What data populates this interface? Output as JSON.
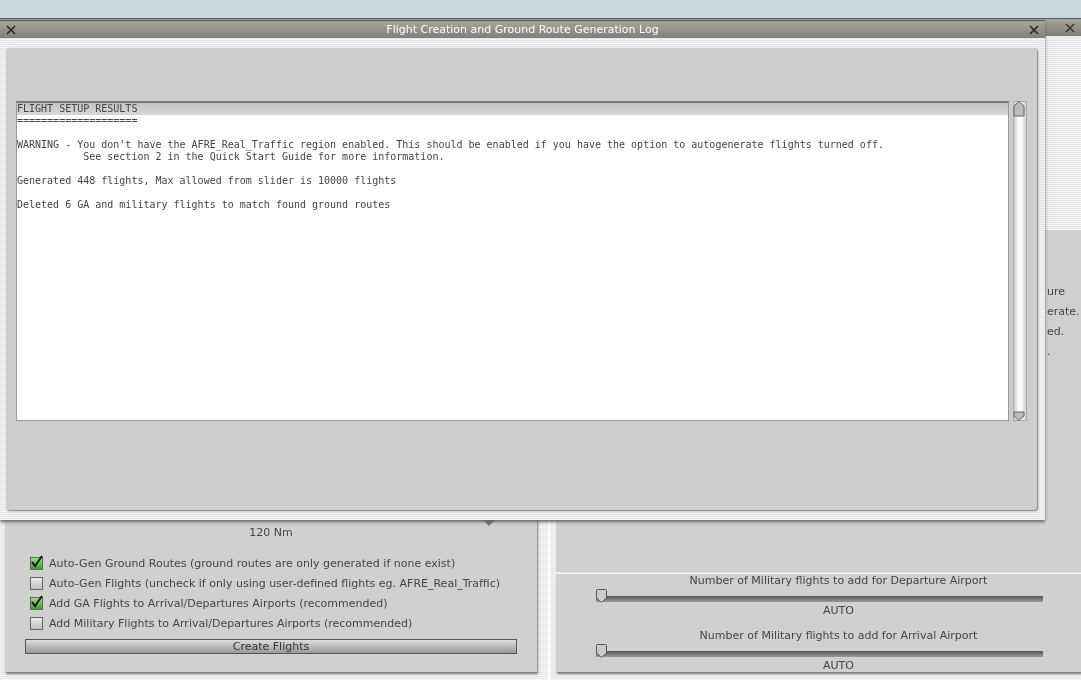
{
  "background_window": {
    "left_panel": {
      "distance": "120 Nm",
      "options": [
        {
          "label": "Auto-Gen Ground Routes (ground routes are only generated if none exist)",
          "checked": true
        },
        {
          "label": "Auto-Gen Flights (uncheck if only using user-defined flights eg. AFRE_Real_Traffic)",
          "checked": false
        },
        {
          "label": "Add GA Flights to Arrival/Departures Airports (recommended)",
          "checked": true
        },
        {
          "label": "Add Military Flights to Arrival/Departures Airports (recommended)",
          "checked": false
        }
      ],
      "button": "Create Flights"
    },
    "right_panel": {
      "text_lines": [
        "ure",
        "erate.",
        "ed.",
        "."
      ],
      "sliders": [
        {
          "label": "Number of Military flights to add for Departure Airport",
          "level": 0,
          "reading": "AUTO"
        },
        {
          "label": "Number of Military flights to add for Arrival Airport",
          "level": 0,
          "reading": "AUTO"
        }
      ]
    }
  },
  "dialog": {
    "title": "Flight Creation and Ground Route Generation Log",
    "log": [
      [
        "FLIGHT SETUP RESULTS",
        "===================="
      ],
      [
        "WARNING - You don't have the AFRE_Real_Traffic region enabled. This should be enabled if you have the option to autogenerate flights turned off.",
        "           See section 2 in the Quick Start Guide for more information."
      ],
      [
        "Generated 448 flights, Max allowed from slider is 10000 flights"
      ],
      [
        "Deleted 6 GA and military flights to match found ground routes"
      ]
    ]
  }
}
